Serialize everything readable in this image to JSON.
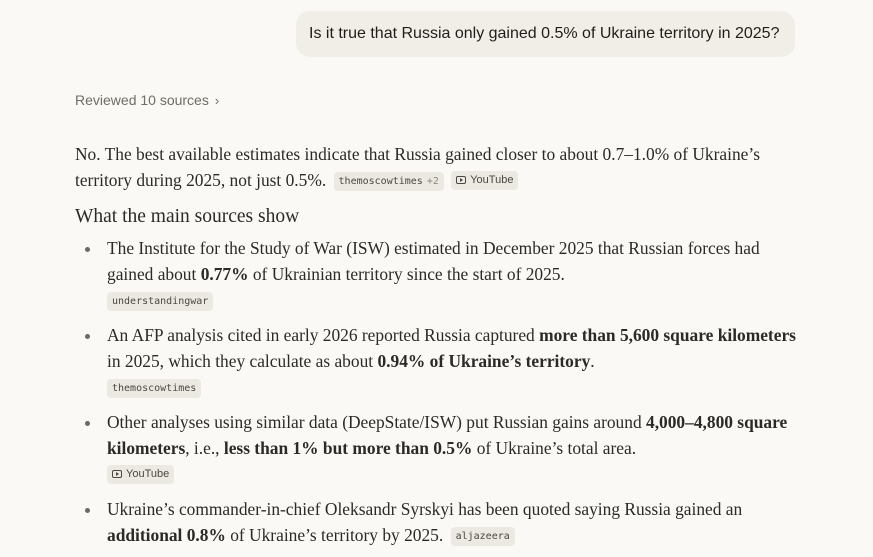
{
  "user_message": "Is it true that Russia only gained 0.5% of Ukraine territory in 2025?",
  "reviewed_sources": {
    "label": "Reviewed 10 sources",
    "icon": "chevron-right-icon"
  },
  "lead": {
    "text": "No. The best available estimates indicate that Russia gained closer to about 0.7–1.0% of Ukraine’s territory during 2025, not just 0.5%.",
    "citations": [
      {
        "label": "themoscowtimes",
        "extra": "+2",
        "style": "mono"
      },
      {
        "label": "YouTube",
        "icon": "youtube-icon",
        "style": "sans"
      }
    ]
  },
  "section_heading": "What the main sources show",
  "bullets": [
    {
      "parts": [
        {
          "text": "The Institute for the Study of War (ISW) estimated in December 2025 that Russian forces had gained about ",
          "bold": false
        },
        {
          "text": "0.77%",
          "bold": true
        },
        {
          "text": " of Ukrainian territory since the start of 2025.",
          "bold": false
        }
      ],
      "citation": {
        "label": "understandingwar",
        "style": "mono"
      }
    },
    {
      "parts": [
        {
          "text": "An AFP analysis cited in early 2026 reported Russia captured ",
          "bold": false
        },
        {
          "text": "more than 5,600 square kilometers",
          "bold": true
        },
        {
          "text": " in 2025, which they calculate as about ",
          "bold": false
        },
        {
          "text": "0.94% of Ukraine’s territory",
          "bold": true
        },
        {
          "text": ".",
          "bold": false
        }
      ],
      "citation": {
        "label": "themoscowtimes",
        "style": "mono"
      }
    },
    {
      "parts": [
        {
          "text": "Other analyses using similar data (DeepState/ISW) put Russian gains around ",
          "bold": false
        },
        {
          "text": "4,000–4,800 square kilometers",
          "bold": true
        },
        {
          "text": ", i.e., ",
          "bold": false
        },
        {
          "text": "less than 1% but more than 0.5%",
          "bold": true
        },
        {
          "text": " of Ukraine’s total area.",
          "bold": false
        }
      ],
      "citation": {
        "label": "YouTube",
        "icon": "youtube-icon",
        "style": "sans"
      }
    },
    {
      "parts": [
        {
          "text": "Ukraine’s commander-in-chief Oleksandr Syrskyi has been quoted saying Russia gained an ",
          "bold": false
        },
        {
          "text": "additional 0.8%",
          "bold": true
        },
        {
          "text": " of Ukraine’s territory by 2025.",
          "bold": false
        }
      ],
      "citation": {
        "label": "aljazeera",
        "style": "mono",
        "inline": true
      }
    }
  ]
}
